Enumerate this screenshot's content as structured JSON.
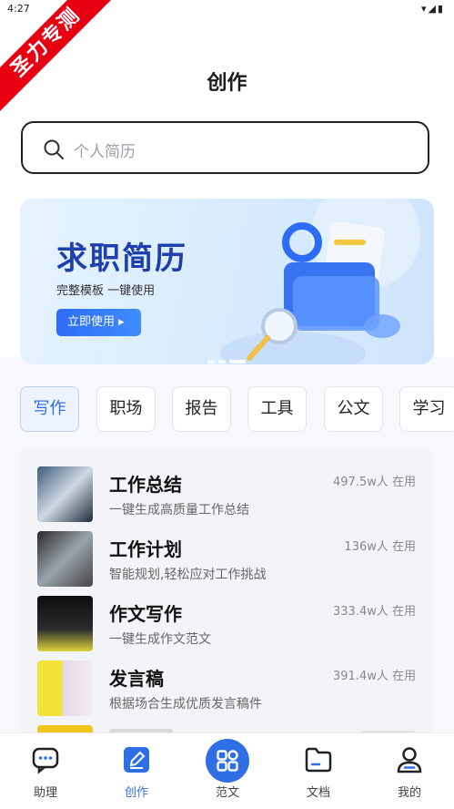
{
  "status_bar": {
    "time": "4:27",
    "icons": "▾◢▮"
  },
  "watermark": "圣力专测",
  "header": {
    "title": "创作"
  },
  "search": {
    "placeholder": "个人简历"
  },
  "banner": {
    "title": "求职简历",
    "subtitle": "完整模板 一键使用",
    "button_label": "立即使用 ▸"
  },
  "tabs": [
    {
      "label": "写作"
    },
    {
      "label": "职场"
    },
    {
      "label": "报告"
    },
    {
      "label": "工具"
    },
    {
      "label": "公文"
    },
    {
      "label": "学习"
    }
  ],
  "list": [
    {
      "name": "工作总结",
      "desc": "一键生成高质量工作总结",
      "count": "497.5w人 在用"
    },
    {
      "name": "工作计划",
      "desc": "智能规划,轻松应对工作挑战",
      "count": "136w人 在用"
    },
    {
      "name": "作文写作",
      "desc": "一键生成作文范文",
      "count": "333.4w人 在用"
    },
    {
      "name": "发言稿",
      "desc": "根据场合生成优质发言稿件",
      "count": "391.4w人 在用"
    }
  ],
  "bottom_nav": [
    {
      "label": "助理",
      "icon": "chat-icon"
    },
    {
      "label": "创作",
      "icon": "edit-icon"
    },
    {
      "label": "范文",
      "icon": "grid-icon"
    },
    {
      "label": "文档",
      "icon": "folder-icon"
    },
    {
      "label": "我的",
      "icon": "user-icon"
    }
  ],
  "colors": {
    "accent": "#2f6fe6",
    "banner_title": "#1f3fae",
    "watermark": "#e60012"
  }
}
